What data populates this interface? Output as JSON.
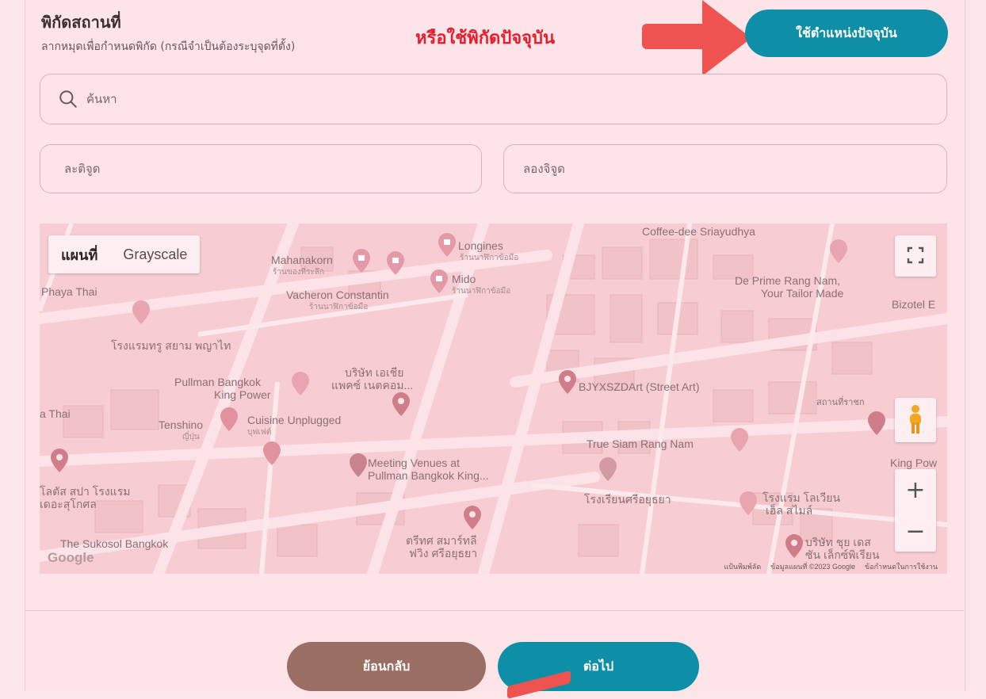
{
  "section": {
    "title": "พิกัดสถานที่",
    "subtitle": "ลากหมุดเพื่อกำหนดพิกัด (กรณีจำเป็นต้องระบุจุดที่ตั้ง)"
  },
  "annotation": {
    "text": "หรือใช้พิกัดปัจจุบัน"
  },
  "current_location_button": "ใช้ตำแหน่งปัจจุบัน",
  "search": {
    "placeholder": "ค้นหา"
  },
  "latitude": {
    "placeholder": "ละติจูด"
  },
  "longitude": {
    "placeholder": "ลองจิจูด"
  },
  "map": {
    "map_types": [
      "แผนที่",
      "Grayscale"
    ],
    "labels": {
      "coffee": "Coffee-dee Sriayudhya",
      "longines": "Longines",
      "longines_sub": "ร้านนาฬิกาข้อมือ",
      "mahanakorn": "Mahanakorn",
      "mahanakorn_sub": "ร้านของที่ระลึก",
      "mido": "Mido",
      "mido_sub": "ร้านนาฬิกาข้อมือ",
      "vacheron": "Vacheron Constantin",
      "vacheron_sub": "ร้านนาฬิกาข้อมือ",
      "phaya_thai": "Phaya Thai",
      "deprime_1": "De Prime Rang Nam,",
      "deprime_2": "Your Tailor Made",
      "bizotel": "Bizotel E",
      "hotel_true": "โรงแรมทรู สยาม พญาไท",
      "asia_1": "บริษัท เอเชีย",
      "asia_2": "แพคซ์ เนตคอม...",
      "pullman_1": "Pullman Bangkok",
      "pullman_2": "King Power",
      "bjy": "BJYXSZDArt (Street Art)",
      "station": "สถานที่ราชก",
      "thai": "a Thai",
      "tenshino": "Tenshino",
      "tenshino_sub": "ญี่ปุ่น",
      "cuisine": "Cuisine Unplugged",
      "cuisine_sub": "บุฟเฟต์",
      "true_siam": "True Siam Rang Nam",
      "king_pow": "King Pow",
      "meeting_1": "Meeting Venues at",
      "meeting_2": "Pullman Bangkok King...",
      "lotus_1": "โลตัส สปา โรงแรม",
      "lotus_2": "เดอะสุโกศล",
      "school": "โรงเรียนศรีอยุธยา",
      "hotel_lavian_1": "โรงแรม โลเวียน",
      "hotel_lavian_2": "เฮ็ล สไมล์",
      "sukosol": "The Sukosol Bangkok",
      "trees_1": "ตรีทศ สมาร์ทลี",
      "trees_2": "ฟวิง ศรีอยุธยา",
      "company_1": "บริษัท ชุย เดส",
      "company_2": "ซัน เล็กซ์พิเรียน"
    },
    "logo": "Google",
    "attribution": [
      "แป้นพิมพ์ลัด",
      "ข้อมูลแผนที่ ©2023 Google",
      "ข้อกำหนดในการใช้งาน"
    ]
  },
  "footer": {
    "back_label": "ย้อนกลับ",
    "next_label": "ต่อไป"
  },
  "colors": {
    "primary": "#0e8fa7",
    "back": "#9b6e64",
    "annotation": "#e51d2d",
    "arrow": "#ef5350",
    "background": "#fde4e9"
  }
}
